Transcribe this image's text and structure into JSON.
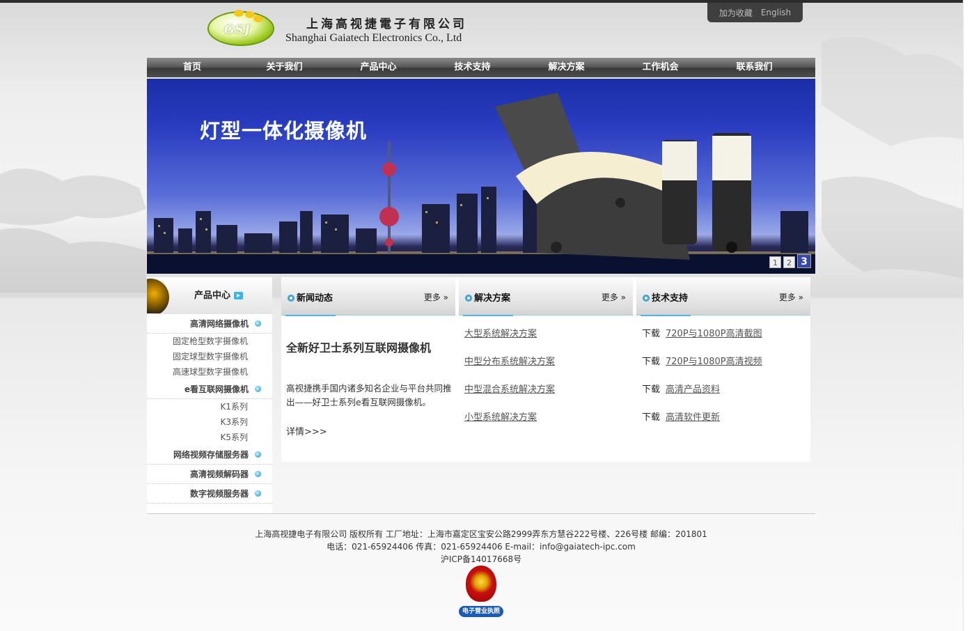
{
  "brand": {
    "logo_text": "GSJ",
    "name_cn": "上海高视捷電子有限公司",
    "name_en": "Shanghai Gaiatech Electronics Co., Ltd"
  },
  "toplinks": {
    "favorite": "加为收藏",
    "english": "English"
  },
  "nav": [
    "首页",
    "关于我们",
    "产品中心",
    "技术支持",
    "解决方案",
    "工作机会",
    "联系我们"
  ],
  "banner": {
    "title": "灯型一体化摄像机",
    "pages": [
      "1",
      "2",
      "3"
    ],
    "active_page": 3
  },
  "sidebar": {
    "title": "产品中心",
    "groups": [
      {
        "label": "高清网络摄像机",
        "items": [
          "固定枪型数字摄像机",
          "固定球型数字摄像机",
          "高速球型数字摄像机"
        ]
      },
      {
        "label": "e看互联网摄像机",
        "items": [
          "K1系列",
          "K3系列",
          "K5系列"
        ]
      },
      {
        "label": "网络视频存储服务器",
        "items": []
      },
      {
        "label": "高清视频解码器",
        "items": []
      },
      {
        "label": "数字视频服务器",
        "items": []
      }
    ]
  },
  "news": {
    "title": "新闻动态",
    "more": "更多 »",
    "headline": "全新好卫士系列互联网摄像机",
    "body": "高视捷携手国内诸多知名企业与平台共同推出——好卫士系列e看互联网摄像机。",
    "detail": "详情>>>"
  },
  "solutions": {
    "title": "解决方案",
    "more": "更多 »",
    "links": [
      "大型系统解决方案",
      "中型分布系统解决方案",
      "中型混合系统解决方案",
      "小型系统解决方案 "
    ]
  },
  "support": {
    "title": "技术支持",
    "more": "更多 »",
    "download_label": "下载",
    "links": [
      "720P与1080P高清截图",
      "720P与1080P高清视频",
      "高清产品资料",
      "高清软件更新"
    ]
  },
  "footer": {
    "line1": "上海高视捷电子有限公司  版权所有  工厂地址：上海市嘉定区宝安公路2999弄东方慧谷222号楼、226号楼  邮编：201801",
    "line2": "电话：021-65924406  传真：021-65924406  E-mail：info@gaiatech-ipc.com",
    "line3": "沪ICP备14017668号",
    "badge": "电子营业执照"
  },
  "colors": {
    "accent": "#3ab6e0",
    "nav_dark": "#3a3a3a",
    "banner_blue": "#2a3cc0"
  }
}
